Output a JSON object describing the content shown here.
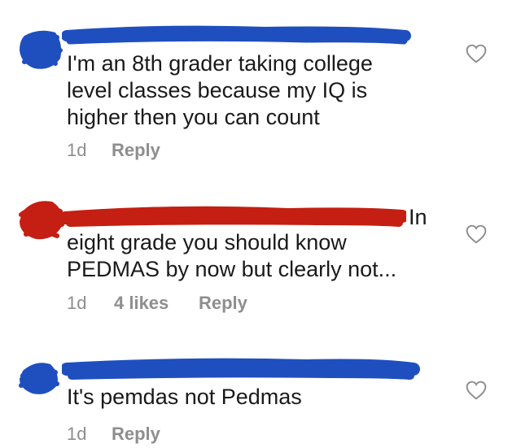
{
  "comments": [
    {
      "body": "I'm an 8th grader taking college\nlevel classes because my IQ is\nhigher then you can count",
      "time": "1d",
      "likes": "",
      "reply_label": "Reply",
      "scribble_color": "#1f4fbf"
    },
    {
      "leaked_text": "In",
      "body": "eight grade you should know\nPEDMAS by now but clearly not...",
      "time": "1d",
      "likes": "4 likes",
      "reply_label": "Reply",
      "scribble_color": "#c41f12"
    },
    {
      "body": "It's pemdas not Pedmas",
      "time": "1d",
      "likes": "",
      "reply_label": "Reply",
      "scribble_color": "#1f4fbf"
    }
  ],
  "icons": {
    "like": "heart-outline-icon"
  }
}
